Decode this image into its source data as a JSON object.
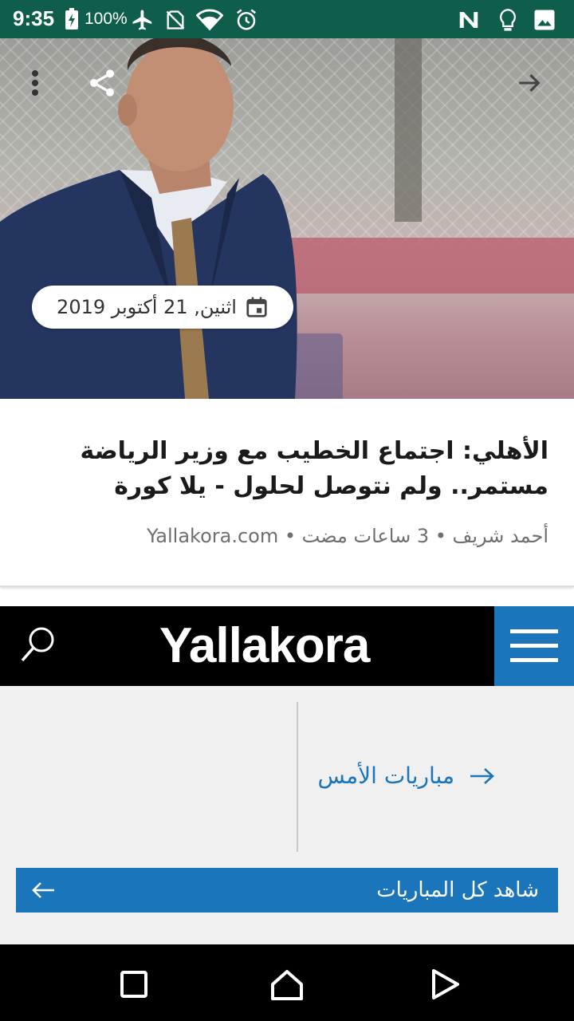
{
  "status_bar": {
    "time": "9:35",
    "battery": "100%",
    "icons": [
      "battery-charging-icon",
      "airplane-mode-icon",
      "no-sim-icon",
      "wifi-icon",
      "alarm-icon",
      "news-app-icon",
      "bulb-icon",
      "image-icon"
    ]
  },
  "hero": {
    "date": "اثنين, 21 أكتوبر 2019",
    "icons": [
      "more-options-icon",
      "share-icon",
      "forward-arrow-icon",
      "calendar-icon"
    ]
  },
  "article": {
    "headline": "الأهلي: اجتماع الخطيب مع وزير الرياضة مستمر.. ولم نتوصل لحلول - يلا كورة",
    "meta": "أحمد شريف • 3 ساعات مضت • Yallakora.com"
  },
  "site": {
    "logo": "Yallakora",
    "yesterday_link": "مباريات الأمس",
    "watch_all": "شاهد كل المباريات",
    "colors": {
      "brand_blue": "#1b75bb",
      "header_black": "#000000",
      "status_green": "#0f5e4c"
    }
  },
  "nav": {
    "icons": [
      "recents-icon",
      "home-icon",
      "back-icon"
    ]
  }
}
